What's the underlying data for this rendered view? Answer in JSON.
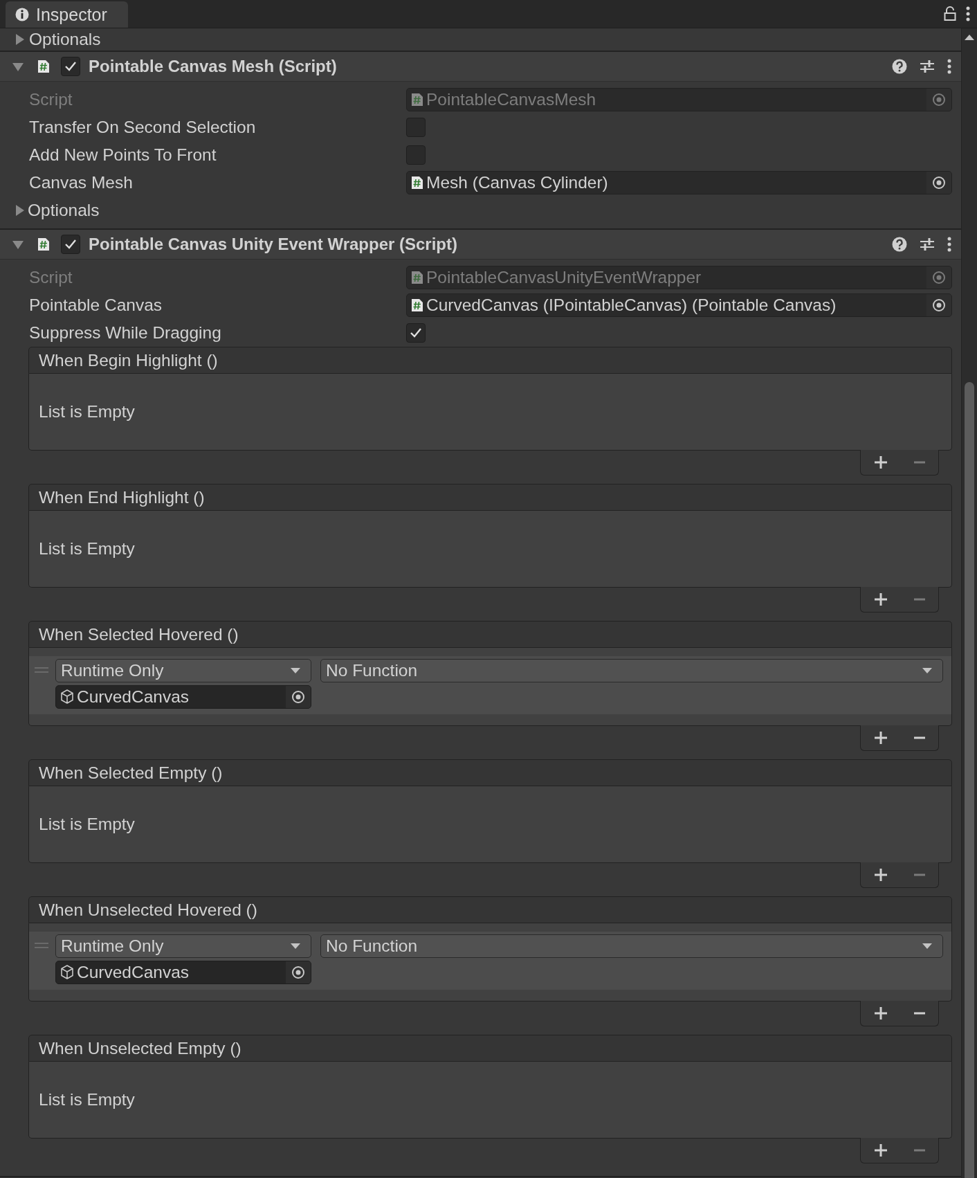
{
  "tab": {
    "title": "Inspector"
  },
  "top_foldout": {
    "label": "Optionals",
    "expanded": false
  },
  "components": [
    {
      "title": "Pointable Canvas Mesh (Script)",
      "expanded": true,
      "enabled": true,
      "fields": [
        {
          "kind": "object",
          "label": "Script",
          "value": "PointableCanvasMesh",
          "disabled": true
        },
        {
          "kind": "checkbox",
          "label": "Transfer On Second Selection",
          "checked": false
        },
        {
          "kind": "checkbox",
          "label": "Add New Points To Front",
          "checked": false
        },
        {
          "kind": "object",
          "label": "Canvas Mesh",
          "value": "Mesh (Canvas Cylinder)",
          "disabled": false
        },
        {
          "kind": "foldout",
          "label": "Optionals",
          "expanded": false
        }
      ]
    },
    {
      "title": "Pointable Canvas Unity Event Wrapper (Script)",
      "expanded": true,
      "enabled": true,
      "fields": [
        {
          "kind": "object",
          "label": "Script",
          "value": "PointableCanvasUnityEventWrapper",
          "disabled": true
        },
        {
          "kind": "object",
          "label": "Pointable Canvas",
          "value": "CurvedCanvas (IPointableCanvas) (Pointable Canvas)",
          "disabled": false
        },
        {
          "kind": "checkbox",
          "label": "Suppress While Dragging",
          "checked": true
        },
        {
          "kind": "event",
          "label": "When Begin Highlight ()",
          "empty_text": "List is Empty",
          "remove_enabled": false
        },
        {
          "kind": "event",
          "label": "When End Highlight ()",
          "empty_text": "List is Empty",
          "remove_enabled": false
        },
        {
          "kind": "event",
          "label": "When Selected Hovered ()",
          "entries": [
            {
              "mode": "Runtime Only",
              "function": "No Function",
              "target": "CurvedCanvas"
            }
          ],
          "remove_enabled": true
        },
        {
          "kind": "event",
          "label": "When Selected Empty ()",
          "empty_text": "List is Empty",
          "remove_enabled": false
        },
        {
          "kind": "event",
          "label": "When Unselected Hovered ()",
          "entries": [
            {
              "mode": "Runtime Only",
              "function": "No Function",
              "target": "CurvedCanvas"
            }
          ],
          "remove_enabled": true
        },
        {
          "kind": "event",
          "label": "When Unselected Empty ()",
          "empty_text": "List is Empty",
          "remove_enabled": false
        }
      ]
    }
  ]
}
